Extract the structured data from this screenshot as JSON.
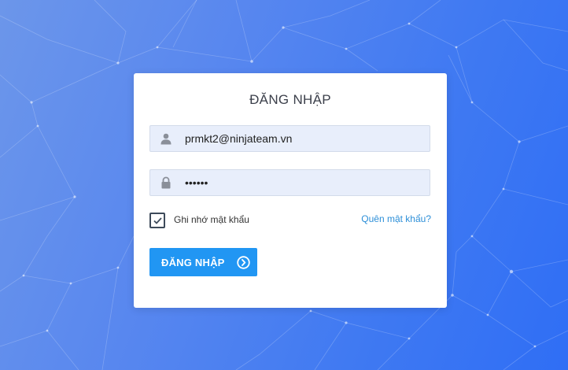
{
  "login": {
    "title": "ĐĂNG NHẬP",
    "email": {
      "value": "prmkt2@ninjateam.vn",
      "icon": "user-icon"
    },
    "password": {
      "value": "••••••",
      "icon": "lock-icon"
    },
    "remember": {
      "label": "Ghi nhớ mật khẩu",
      "checked": true
    },
    "forgot_label": "Quên mật khẩu?",
    "submit_label": "ĐĂNG NHẬP",
    "submit_icon": "chevron-circle-right-icon"
  },
  "colors": {
    "primary": "#2196f3",
    "link": "#2d8fd8",
    "background_start": "#6c96ea",
    "background_end": "#2f6ef5"
  }
}
